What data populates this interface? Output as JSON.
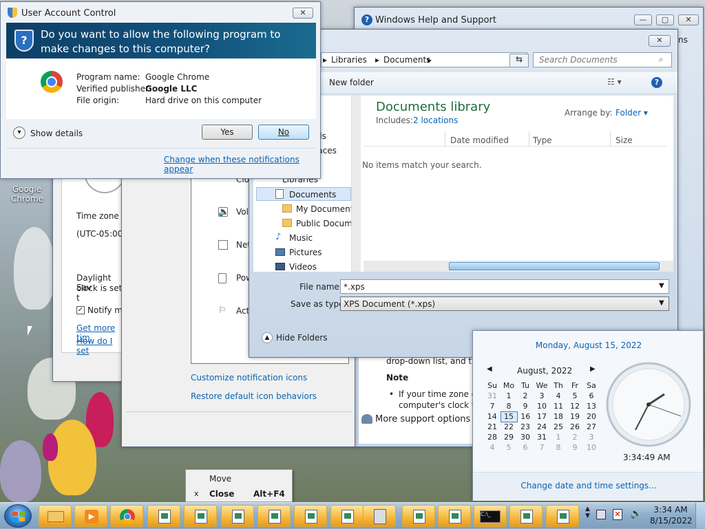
{
  "uac": {
    "title": "User Account Control",
    "question": "Do you want to allow the following program to make changes to this computer?",
    "program_label": "Program name:",
    "program_value": "Google Chrome",
    "publisher_label": "Verified publisher:",
    "publisher_value": "Google LLC",
    "origin_label": "File origin:",
    "origin_value": "Hard drive on this computer",
    "show_details": "Show details",
    "yes": "Yes",
    "no": "No",
    "change_link": "Change when these notifications appear",
    "close": "✕"
  },
  "help": {
    "title": "Windows Help and Support",
    "min": "—",
    "max": "▢",
    "close": "✕",
    "text1": "drop-down list, and then",
    "note": "Note",
    "bullet": "If your time zone obs",
    "bullet2": "computer's clock to",
    "more": "More support options",
    "partial": "ns"
  },
  "datetime_win": {
    "time_zone_label": "Time zone",
    "time_zone_value": "(UTC-05:00)",
    "dst1": "Daylight Sav",
    "dst2": "clock is set t",
    "notify": "Notify m",
    "link1": "Get more tim",
    "link2": "How do I set"
  },
  "notif_area": {
    "items": [
      "Clo",
      "Vol",
      "Net",
      "Pow",
      "Act"
    ],
    "customize": "Customize notification icons",
    "restore": "Restore default icon behaviors"
  },
  "save_dialog": {
    "breadcrumb": [
      "Libraries",
      "Documents"
    ],
    "search_placeholder": "Search Documents",
    "new_folder": "New folder",
    "lib_title": "Documents library",
    "includes_label": "Includes:",
    "includes_link": "2 locations",
    "arrange_label": "Arrange by:",
    "arrange_value": "Folder",
    "columns": [
      "Date modified",
      "Type",
      "Size"
    ],
    "empty": "No items match your search.",
    "nav_partial": [
      "ds",
      "laces"
    ],
    "nav": [
      "Libraries",
      "Documents",
      "My Documents",
      "Public Docume",
      "Music",
      "Pictures",
      "Videos"
    ],
    "filename_label": "File name:",
    "filename_value": "*.xps",
    "savetype_label": "Save as type:",
    "savetype_value": "XPS Document (*.xps)",
    "hide_folders": "Hide Folders",
    "close": "✕"
  },
  "clock_popup": {
    "date_header": "Monday, August 15, 2022",
    "month": "August, 2022",
    "days": [
      "Su",
      "Mo",
      "Tu",
      "We",
      "Th",
      "Fr",
      "Sa"
    ],
    "weeks": [
      [
        "31",
        "1",
        "2",
        "3",
        "4",
        "5",
        "6"
      ],
      [
        "7",
        "8",
        "9",
        "10",
        "11",
        "12",
        "13"
      ],
      [
        "14",
        "15",
        "16",
        "17",
        "18",
        "19",
        "20"
      ],
      [
        "21",
        "22",
        "23",
        "24",
        "25",
        "26",
        "27"
      ],
      [
        "28",
        "29",
        "30",
        "31",
        "1",
        "2",
        "3"
      ],
      [
        "4",
        "5",
        "6",
        "7",
        "8",
        "9",
        "10"
      ]
    ],
    "time": "3:34:49 AM",
    "change": "Change date and time settings..."
  },
  "context_menu": {
    "move": "Move",
    "close": "Close",
    "close_shortcut": "Alt+F4",
    "x": "x"
  },
  "desktop": {
    "chrome_label1": "Google",
    "chrome_label2": "Chrome"
  },
  "taskbar": {
    "clock_time": "3:34 AM",
    "clock_date": "8/15/2022"
  }
}
